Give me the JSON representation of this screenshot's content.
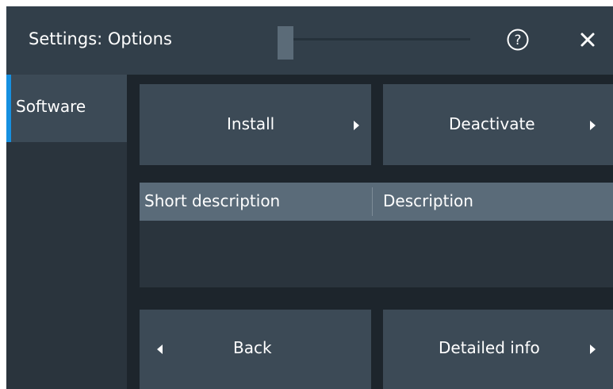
{
  "dialog": {
    "title": "Settings: Options",
    "help_icon": "help-circle-icon",
    "help_glyph": "?",
    "close_icon": "close-icon",
    "close_glyph": "✕"
  },
  "sidebar": {
    "items": [
      {
        "label": "Software",
        "selected": true
      }
    ]
  },
  "main": {
    "install_label": "Install",
    "deactivate_label": "Deactivate",
    "back_label": "Back",
    "detailed_info_label": "Detailed info",
    "table": {
      "columns": [
        "Short description",
        "Description"
      ],
      "rows": []
    }
  },
  "colors": {
    "accent": "#1690e0",
    "titlebar": "#323f4a",
    "button": "#3c4a56",
    "table_header": "#5a6b79",
    "background": "#1d252c"
  }
}
